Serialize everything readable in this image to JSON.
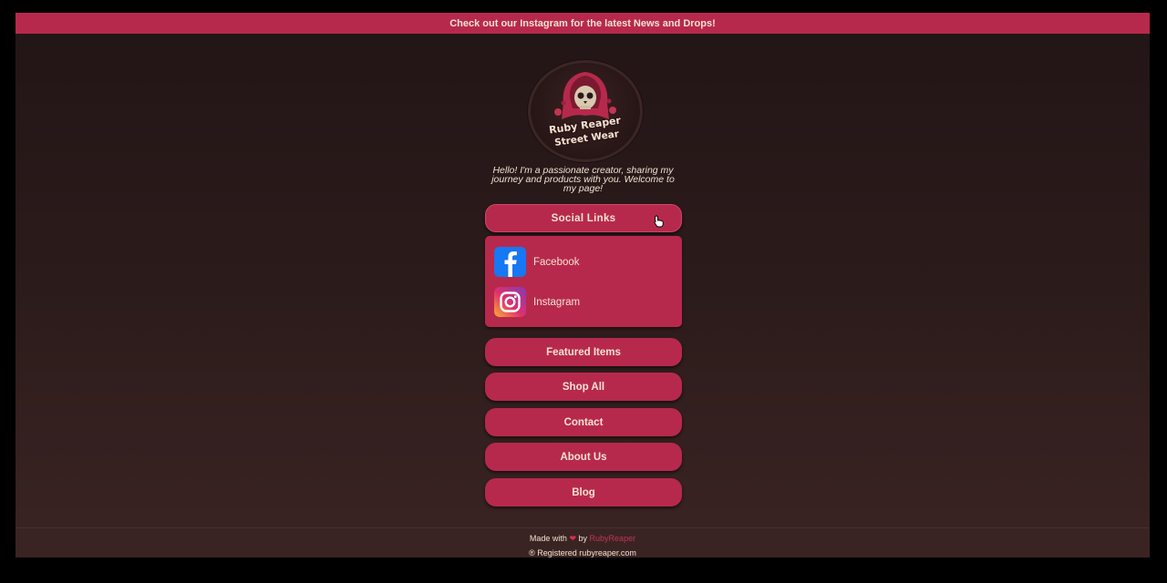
{
  "banner": {
    "text": "Check out our Instagram for the latest News and Drops!"
  },
  "logo": {
    "line1": "Ruby Reaper",
    "line2": "Street Wear"
  },
  "bio": {
    "text": "Hello! I'm a passionate creator, sharing my journey and products with you. Welcome to my page!"
  },
  "social": {
    "toggle_label": "Social Links",
    "items": [
      {
        "label": "Facebook",
        "icon": "facebook-icon"
      },
      {
        "label": "Instagram",
        "icon": "instagram-icon"
      }
    ]
  },
  "buttons": [
    {
      "label": "Featured Items"
    },
    {
      "label": "Shop All"
    },
    {
      "label": "Contact"
    },
    {
      "label": "About Us"
    },
    {
      "label": "Blog"
    }
  ],
  "footer": {
    "made_with": "Made with",
    "heart": "❤",
    "by": "by",
    "author": "RubyReaper",
    "registered": "® Registered rubyreaper.com"
  },
  "colors": {
    "accent": "#b7294c",
    "text": "#f3e3d2",
    "background_top": "#221516",
    "background_bottom": "#3a2423",
    "facebook": "#1877f2"
  }
}
